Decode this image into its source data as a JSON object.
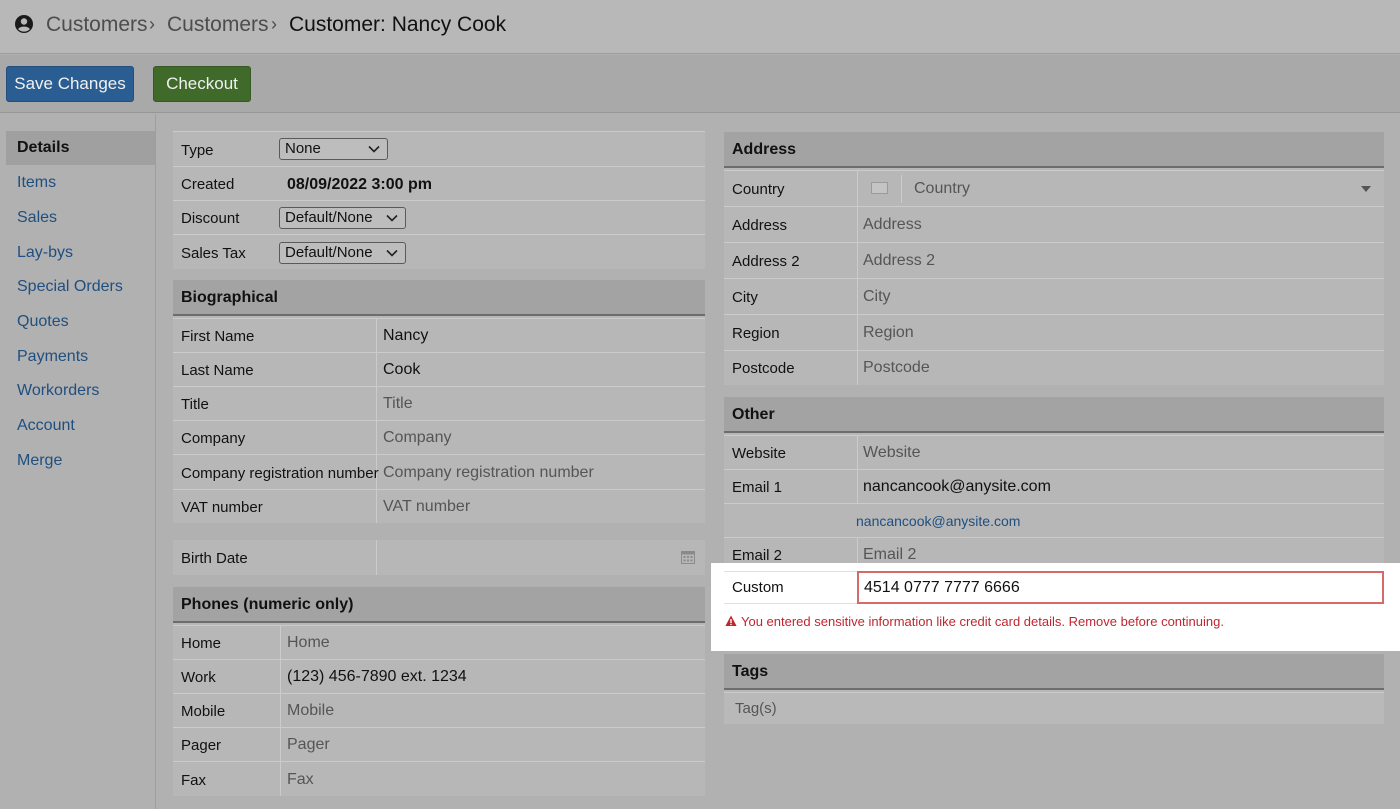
{
  "breadcrumb": {
    "item1": "Customers",
    "item2": "Customers",
    "current": "Customer:  Nancy Cook"
  },
  "toolbar": {
    "save_label": "Save Changes",
    "checkout_label": "Checkout"
  },
  "sidebar": {
    "items": [
      "Details",
      "Items",
      "Sales",
      "Lay-bys",
      "Special Orders",
      "Quotes",
      "Payments",
      "Workorders",
      "Account",
      "Merge"
    ],
    "active": "Details"
  },
  "general": {
    "type_label": "Type",
    "type_value": "None",
    "created_label": "Created",
    "created_value": "08/09/2022 3:00 pm",
    "discount_label": "Discount",
    "discount_value": "Default/None",
    "salestax_label": "Sales Tax",
    "salestax_value": "Default/None"
  },
  "biographical": {
    "title": "Biographical",
    "first_name_label": "First Name",
    "first_name_value": "Nancy",
    "last_name_label": "Last Name",
    "last_name_value": "Cook",
    "title_label": "Title",
    "title_placeholder": "Title",
    "company_label": "Company",
    "company_placeholder": "Company",
    "company_reg_label": "Company registration number",
    "company_reg_placeholder": "Company registration number",
    "vat_label": "VAT number",
    "vat_placeholder": "VAT number"
  },
  "birth": {
    "label": "Birth Date"
  },
  "phones": {
    "title": "Phones (numeric only)",
    "home_label": "Home",
    "home_placeholder": "Home",
    "work_label": "Work",
    "work_value": "(123) 456-7890 ext. 1234",
    "mobile_label": "Mobile",
    "mobile_placeholder": "Mobile",
    "pager_label": "Pager",
    "pager_placeholder": "Pager",
    "fax_label": "Fax",
    "fax_placeholder": "Fax"
  },
  "address": {
    "title": "Address",
    "country_label": "Country",
    "country_placeholder": "Country",
    "address_label": "Address",
    "address_placeholder": "Address",
    "address2_label": "Address 2",
    "address2_placeholder": "Address 2",
    "city_label": "City",
    "city_placeholder": "City",
    "region_label": "Region",
    "region_placeholder": "Region",
    "postcode_label": "Postcode",
    "postcode_placeholder": "Postcode"
  },
  "other": {
    "title": "Other",
    "website_label": "Website",
    "website_placeholder": "Website",
    "email1_label": "Email 1",
    "email1_value": "nancancook@anysite.com",
    "email1_link": "nancancook@anysite.com",
    "email2_label": "Email 2",
    "email2_placeholder": "Email 2",
    "custom_label": "Custom",
    "custom_value": "4514 0777 7777 6666",
    "warning": "You entered sensitive information like credit card details. Remove before continuing."
  },
  "tags": {
    "title": "Tags",
    "placeholder": "Tag(s)"
  },
  "colors": {
    "save_button": "#2a5e92",
    "checkout_button": "#3f6a2a",
    "link": "#1f4f80",
    "error": "#c0262e",
    "error_border": "#d46a6a"
  },
  "icons": {
    "user": "user-circle-icon",
    "chevron": "chevron-down-icon",
    "calendar": "calendar-icon",
    "flag": "flag-icon",
    "warning": "warning-icon"
  }
}
